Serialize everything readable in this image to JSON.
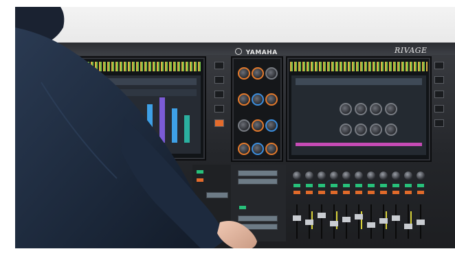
{
  "scene": {
    "brand_left": "YAMAHA",
    "brand_right": "RIVAGE",
    "brand_sub": "",
    "description_colors": {
      "console": "#24262a",
      "meter_yellow": "#f2c24a",
      "meter_green": "#7fd14b",
      "knob_ring_orange": "#e47a2c",
      "knob_ring_blue": "#3c8fe0",
      "button_green": "#28c07a",
      "button_orange": "#e46b2c",
      "shirt_navy": "#1e2b3f"
    }
  },
  "icons": {
    "yamaha_logo": "tuning-fork-logo-icon"
  }
}
